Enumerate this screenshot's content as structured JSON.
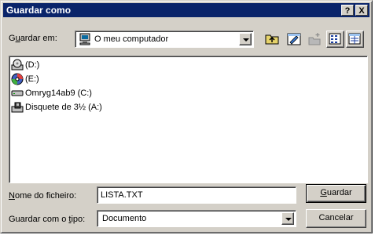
{
  "window": {
    "title": "Guardar como",
    "help_glyph": "?",
    "close_glyph": "X"
  },
  "lookin": {
    "label_pre": "G",
    "label_u": "u",
    "label_post": "ardar em:",
    "value": "O meu computador"
  },
  "files": [
    {
      "name": "(D:)",
      "icon": "cd-drive-icon"
    },
    {
      "name": "(E:)",
      "icon": "dvd-drive-icon"
    },
    {
      "name": "Omryg14ab9 (C:)",
      "icon": "hard-drive-icon"
    },
    {
      "name": "Disquete de 3½ (A:)",
      "icon": "floppy-drive-icon"
    }
  ],
  "filename": {
    "label_pre": "",
    "label_u": "N",
    "label_post": "ome do ficheiro:",
    "value": "LISTA.TXT"
  },
  "filetype": {
    "label_pre": "Guardar com o ",
    "label_u": "t",
    "label_post": "ipo:",
    "value": "Documento"
  },
  "buttons": {
    "save_u": "G",
    "save_rest": "uardar",
    "cancel": "Cancelar"
  }
}
